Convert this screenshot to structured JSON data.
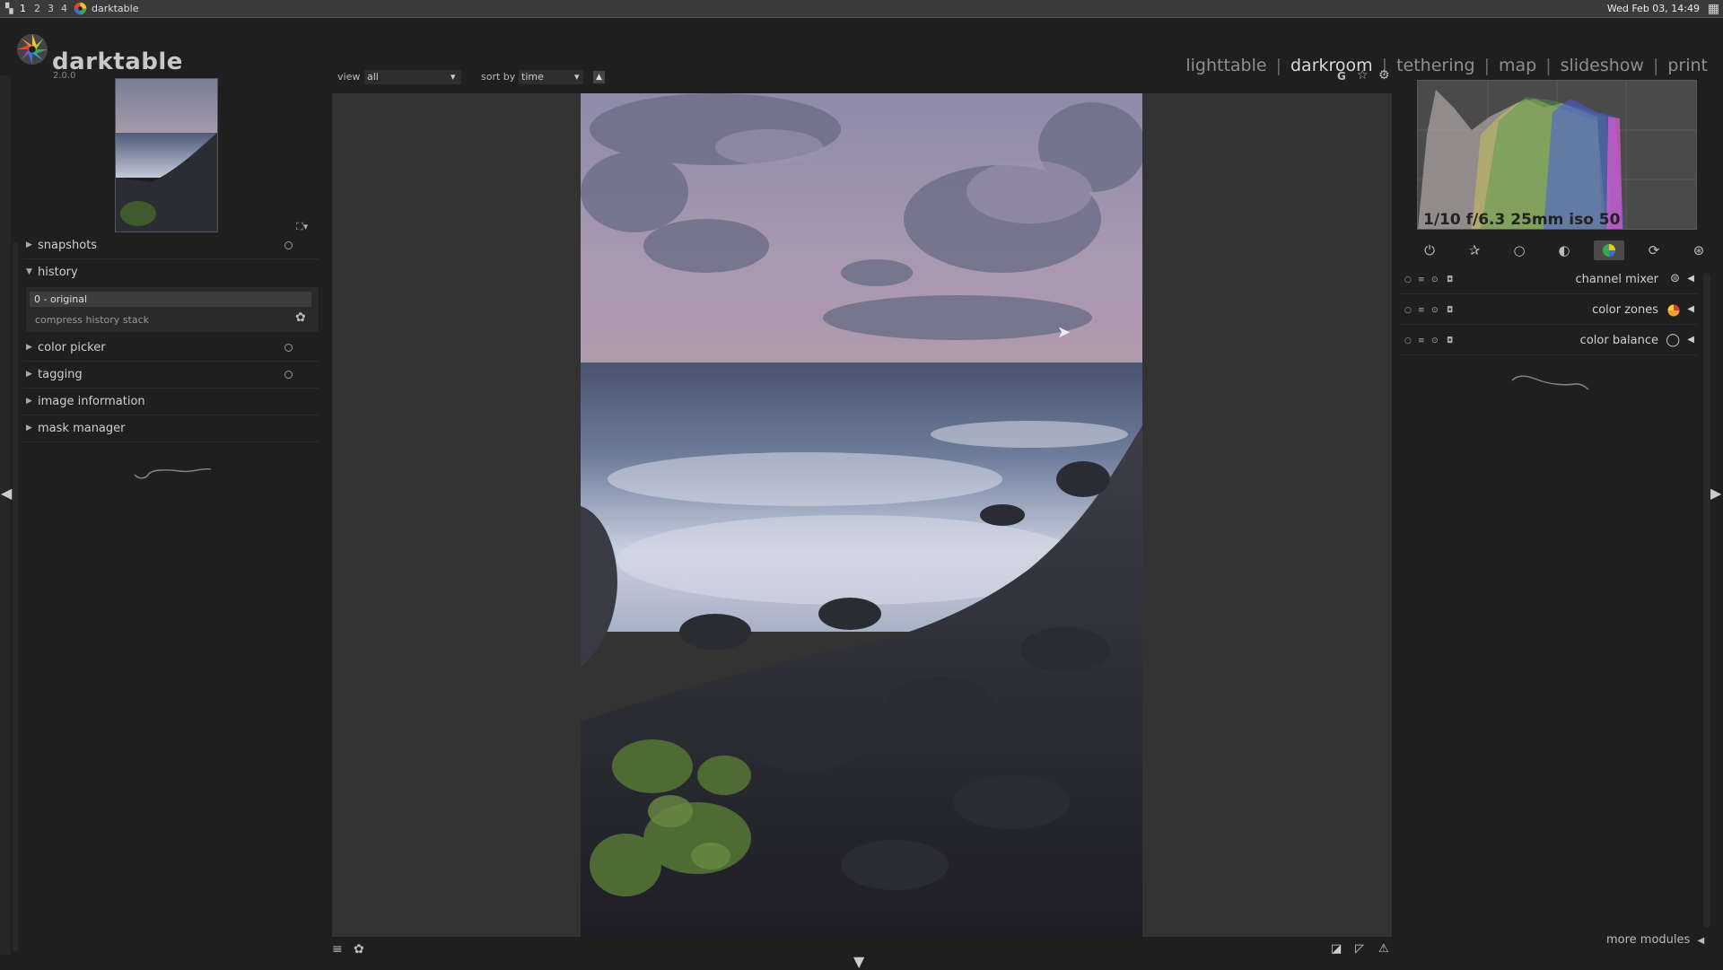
{
  "system_bar": {
    "workspaces": [
      "1",
      "2",
      "3",
      "4"
    ],
    "window_title": "darktable",
    "clock": "Wed Feb 03, 14:49"
  },
  "header": {
    "app_name": "darktable",
    "version": "2.0.0",
    "views": [
      "lighttable",
      "darkroom",
      "tethering",
      "map",
      "slideshow",
      "print"
    ],
    "active_view": "darkroom"
  },
  "filter_bar": {
    "view_label": "view",
    "view_value": "all",
    "sort_label": "sort by",
    "sort_value": "time",
    "grouping_label": "G"
  },
  "left_panel": {
    "sections": [
      {
        "label": "snapshots",
        "expanded": false
      },
      {
        "label": "history",
        "expanded": true
      },
      {
        "label": "color picker",
        "expanded": false
      },
      {
        "label": "tagging",
        "expanded": false
      },
      {
        "label": "image information",
        "expanded": false
      },
      {
        "label": "mask manager",
        "expanded": false
      }
    ],
    "history_items": [
      "0 - original"
    ],
    "compress_history": "compress history stack"
  },
  "right_panel": {
    "exif": "1/10 f/6.3 25mm iso 50",
    "module_groups": [
      "power-icon",
      "favorites-icon",
      "basic-circle-icon",
      "tone-icon",
      "color-icon",
      "correct-icon",
      "effect-icon"
    ],
    "active_group": "color-icon",
    "modules": [
      {
        "name": "channel mixer"
      },
      {
        "name": "color zones"
      },
      {
        "name": "color balance"
      }
    ],
    "more_modules": "more modules"
  },
  "colors": {
    "active_view": "#d9d9d9",
    "panel_bg": "#1f1f1f",
    "center_bg": "#333333"
  }
}
